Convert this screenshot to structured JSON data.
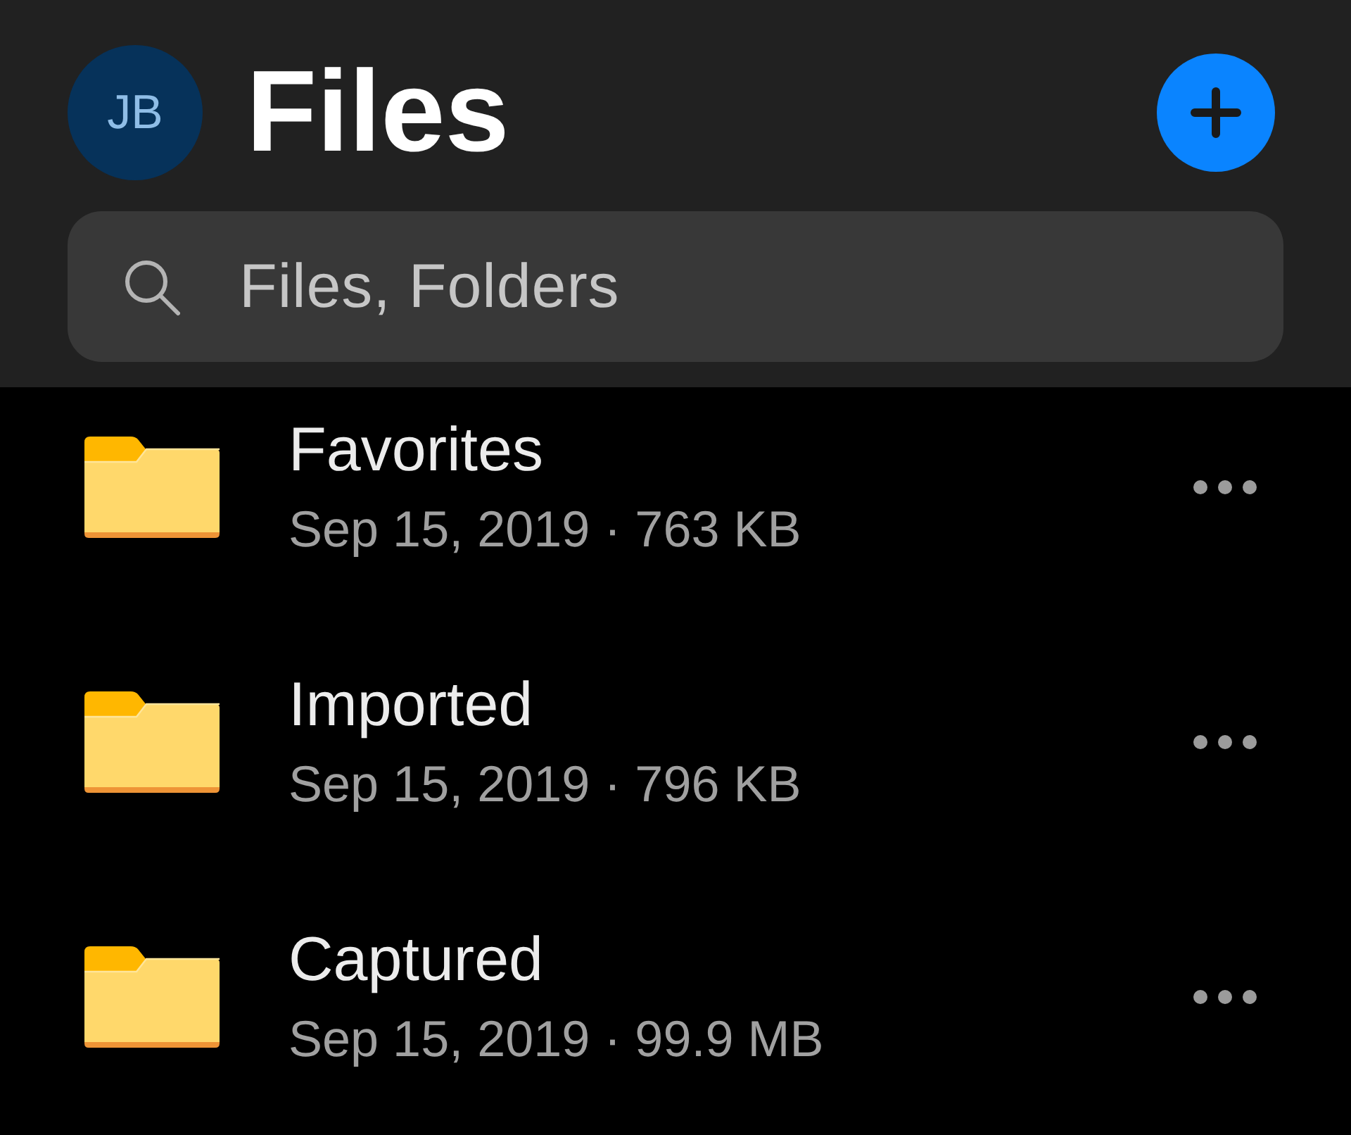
{
  "header": {
    "avatar": {
      "initials": "JB"
    },
    "title": "Files"
  },
  "search": {
    "placeholder": "Files, Folders"
  },
  "folders": [
    {
      "name": "Favorites",
      "details": "Sep 15, 2019 · 763 KB"
    },
    {
      "name": "Imported",
      "details": "Sep 15, 2019 · 796 KB"
    },
    {
      "name": "Captured",
      "details": "Sep 15, 2019 · 99.9 MB"
    }
  ]
}
